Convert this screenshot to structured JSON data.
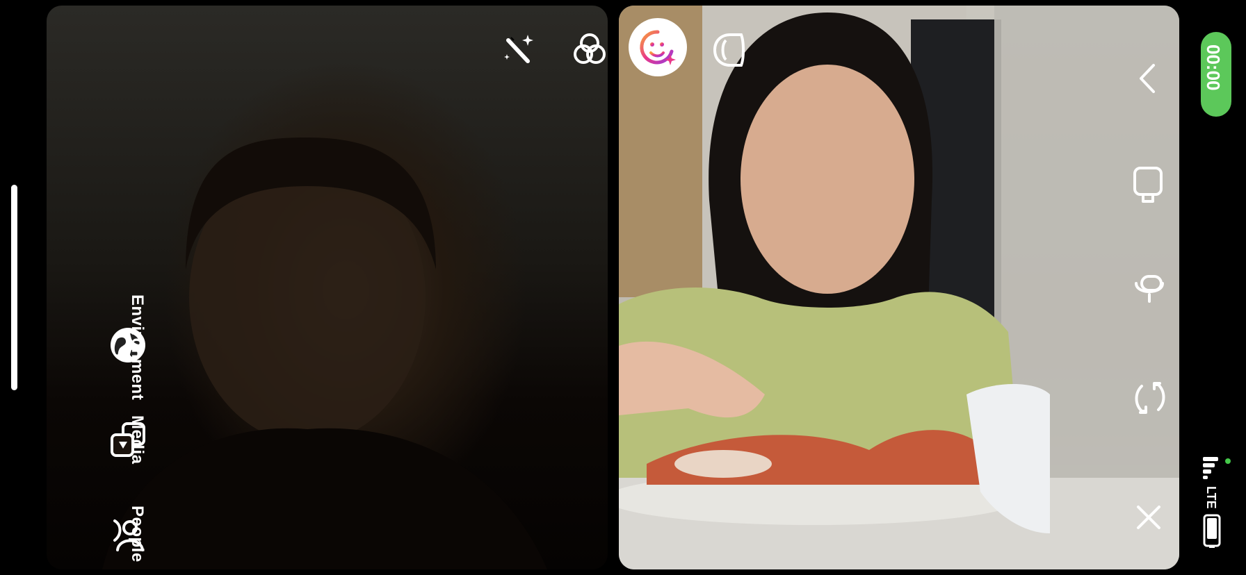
{
  "left_tile": {
    "participant": "self",
    "effects_toolbar": [
      {
        "name": "magic-wand-icon"
      },
      {
        "name": "filters-icon"
      }
    ],
    "side_menu": [
      {
        "label": "Environment",
        "icon": "globe-icon"
      },
      {
        "label": "Media",
        "icon": "media-icon"
      },
      {
        "label": "People",
        "icon": "people-icon"
      }
    ]
  },
  "right_tile": {
    "participant": "remote",
    "top_icons": [
      {
        "name": "ai-effects-icon",
        "active": true
      },
      {
        "name": "face-effect-icon"
      }
    ],
    "controls": [
      {
        "name": "back-icon"
      },
      {
        "name": "camera-off-icon"
      },
      {
        "name": "microphone-icon"
      },
      {
        "name": "flip-camera-icon"
      },
      {
        "name": "end-call-icon"
      }
    ]
  },
  "status_bar": {
    "timer": "00:00",
    "network": "LTE",
    "accent_color": "#5cc85a"
  }
}
